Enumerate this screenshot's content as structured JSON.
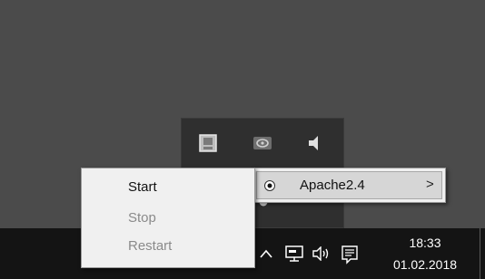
{
  "tray_popup": {
    "icons": [
      "app-config-icon",
      "nvidia-icon",
      "volume-icon",
      "apache-monitor-icon"
    ]
  },
  "apache_menu": {
    "label": "Apache2.4",
    "arrow": ">",
    "selected": true
  },
  "service_menu": {
    "items": [
      {
        "label": "Start",
        "enabled": true
      },
      {
        "label": "Stop",
        "enabled": false
      },
      {
        "label": "Restart",
        "enabled": false
      }
    ]
  },
  "taskbar": {
    "chevron": "^",
    "clock_time": "18:33",
    "clock_date": "01.02.2018",
    "icons": [
      "chevron-up-icon",
      "network-icon",
      "volume-icon",
      "notification-icon"
    ]
  },
  "colors": {
    "desktop": "#4b4b4b",
    "taskbar": "#141414",
    "menu_bg": "#f0f0f0",
    "disabled_text": "#8a8a8a"
  }
}
